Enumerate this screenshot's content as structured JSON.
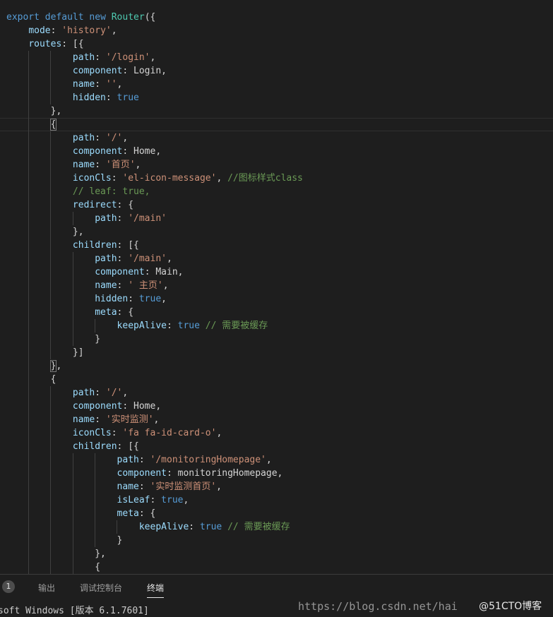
{
  "editor": {
    "lines": [
      [
        [
          "kw",
          "export"
        ],
        [
          "plain",
          " "
        ],
        [
          "kw",
          "default"
        ],
        [
          "plain",
          " "
        ],
        [
          "kw",
          "new"
        ],
        [
          "plain",
          " "
        ],
        [
          "fn",
          "Router"
        ],
        [
          "plain",
          "({"
        ]
      ],
      [
        [
          "plain",
          "    "
        ],
        [
          "prop",
          "mode"
        ],
        [
          "plain",
          ": "
        ],
        [
          "str",
          "'history'"
        ],
        [
          "plain",
          ","
        ]
      ],
      [
        [
          "plain",
          "    "
        ],
        [
          "prop",
          "routes"
        ],
        [
          "plain",
          ": [{"
        ]
      ],
      [
        [
          "plain",
          "            "
        ],
        [
          "prop",
          "path"
        ],
        [
          "plain",
          ": "
        ],
        [
          "str",
          "'/login'"
        ],
        [
          "plain",
          ","
        ]
      ],
      [
        [
          "plain",
          "            "
        ],
        [
          "prop",
          "component"
        ],
        [
          "plain",
          ": Login,"
        ]
      ],
      [
        [
          "plain",
          "            "
        ],
        [
          "prop",
          "name"
        ],
        [
          "plain",
          ": "
        ],
        [
          "str",
          "''"
        ],
        [
          "plain",
          ","
        ]
      ],
      [
        [
          "plain",
          "            "
        ],
        [
          "prop",
          "hidden"
        ],
        [
          "plain",
          ": "
        ],
        [
          "kw",
          "true"
        ]
      ],
      [
        [
          "plain",
          "        },"
        ]
      ],
      [
        [
          "plain",
          "        "
        ],
        [
          "box",
          "{"
        ]
      ],
      [
        [
          "plain",
          "            "
        ],
        [
          "prop",
          "path"
        ],
        [
          "plain",
          ": "
        ],
        [
          "str",
          "'/'"
        ],
        [
          "plain",
          ","
        ]
      ],
      [
        [
          "plain",
          "            "
        ],
        [
          "prop",
          "component"
        ],
        [
          "plain",
          ": Home,"
        ]
      ],
      [
        [
          "plain",
          "            "
        ],
        [
          "prop",
          "name"
        ],
        [
          "plain",
          ": "
        ],
        [
          "str",
          "'首页'"
        ],
        [
          "plain",
          ","
        ]
      ],
      [
        [
          "plain",
          "            "
        ],
        [
          "prop",
          "iconCls"
        ],
        [
          "plain",
          ": "
        ],
        [
          "str",
          "'el-icon-message'"
        ],
        [
          "plain",
          ", "
        ],
        [
          "com",
          "//图标样式class"
        ]
      ],
      [
        [
          "plain",
          "            "
        ],
        [
          "com",
          "// leaf: true,"
        ]
      ],
      [
        [
          "plain",
          "            "
        ],
        [
          "prop",
          "redirect"
        ],
        [
          "plain",
          ": {"
        ]
      ],
      [
        [
          "plain",
          "                "
        ],
        [
          "prop",
          "path"
        ],
        [
          "plain",
          ": "
        ],
        [
          "str",
          "'/main'"
        ]
      ],
      [
        [
          "plain",
          "            },"
        ]
      ],
      [
        [
          "plain",
          "            "
        ],
        [
          "prop",
          "children"
        ],
        [
          "plain",
          ": [{"
        ]
      ],
      [
        [
          "plain",
          "                "
        ],
        [
          "prop",
          "path"
        ],
        [
          "plain",
          ": "
        ],
        [
          "str",
          "'/main'"
        ],
        [
          "plain",
          ","
        ]
      ],
      [
        [
          "plain",
          "                "
        ],
        [
          "prop",
          "component"
        ],
        [
          "plain",
          ": Main,"
        ]
      ],
      [
        [
          "plain",
          "                "
        ],
        [
          "prop",
          "name"
        ],
        [
          "plain",
          ": "
        ],
        [
          "str",
          "' 主页'"
        ],
        [
          "plain",
          ","
        ]
      ],
      [
        [
          "plain",
          "                "
        ],
        [
          "prop",
          "hidden"
        ],
        [
          "plain",
          ": "
        ],
        [
          "kw",
          "true"
        ],
        [
          "plain",
          ","
        ]
      ],
      [
        [
          "plain",
          "                "
        ],
        [
          "prop",
          "meta"
        ],
        [
          "plain",
          ": {"
        ]
      ],
      [
        [
          "plain",
          "                    "
        ],
        [
          "prop",
          "keepAlive"
        ],
        [
          "plain",
          ": "
        ],
        [
          "kw",
          "true"
        ],
        [
          "plain",
          " "
        ],
        [
          "com",
          "// 需要被缓存"
        ]
      ],
      [
        [
          "plain",
          "                }"
        ]
      ],
      [
        [
          "plain",
          "            }]"
        ]
      ],
      [
        [
          "plain",
          "        "
        ],
        [
          "box",
          "}"
        ],
        [
          "plain",
          ","
        ]
      ],
      [
        [
          "plain",
          "        {"
        ]
      ],
      [
        [
          "plain",
          "            "
        ],
        [
          "prop",
          "path"
        ],
        [
          "plain",
          ": "
        ],
        [
          "str",
          "'/'"
        ],
        [
          "plain",
          ","
        ]
      ],
      [
        [
          "plain",
          "            "
        ],
        [
          "prop",
          "component"
        ],
        [
          "plain",
          ": Home,"
        ]
      ],
      [
        [
          "plain",
          "            "
        ],
        [
          "prop",
          "name"
        ],
        [
          "plain",
          ": "
        ],
        [
          "str",
          "'实时监测'"
        ],
        [
          "plain",
          ","
        ]
      ],
      [
        [
          "plain",
          "            "
        ],
        [
          "prop",
          "iconCls"
        ],
        [
          "plain",
          ": "
        ],
        [
          "str",
          "'fa fa-id-card-o'"
        ],
        [
          "plain",
          ","
        ]
      ],
      [
        [
          "plain",
          "            "
        ],
        [
          "prop",
          "children"
        ],
        [
          "plain",
          ": [{"
        ]
      ],
      [
        [
          "plain",
          "                    "
        ],
        [
          "prop",
          "path"
        ],
        [
          "plain",
          ": "
        ],
        [
          "str",
          "'/monitoringHomepage'"
        ],
        [
          "plain",
          ","
        ]
      ],
      [
        [
          "plain",
          "                    "
        ],
        [
          "prop",
          "component"
        ],
        [
          "plain",
          ": monitoringHomepage,"
        ]
      ],
      [
        [
          "plain",
          "                    "
        ],
        [
          "prop",
          "name"
        ],
        [
          "plain",
          ": "
        ],
        [
          "str",
          "'实时监测首页'"
        ],
        [
          "plain",
          ","
        ]
      ],
      [
        [
          "plain",
          "                    "
        ],
        [
          "prop",
          "isLeaf"
        ],
        [
          "plain",
          ": "
        ],
        [
          "kw",
          "true"
        ],
        [
          "plain",
          ","
        ]
      ],
      [
        [
          "plain",
          "                    "
        ],
        [
          "prop",
          "meta"
        ],
        [
          "plain",
          ": {"
        ]
      ],
      [
        [
          "plain",
          "                        "
        ],
        [
          "prop",
          "keepAlive"
        ],
        [
          "plain",
          ": "
        ],
        [
          "kw",
          "true"
        ],
        [
          "plain",
          " "
        ],
        [
          "com",
          "// 需要被缓存"
        ]
      ],
      [
        [
          "plain",
          "                    }"
        ]
      ],
      [
        [
          "plain",
          "                },"
        ]
      ],
      [
        [
          "plain",
          "                {"
        ]
      ]
    ],
    "current_line": 8
  },
  "panel": {
    "badge": "1",
    "tabs": [
      "输出",
      "调试控制台",
      "终端"
    ],
    "active_tab": 2,
    "terminal_text": "soft Windows [版本 6.1.7601]"
  },
  "watermark": {
    "url_text": "https://blog.csdn.net/hai",
    "brand_text": "@51CTO博客"
  }
}
